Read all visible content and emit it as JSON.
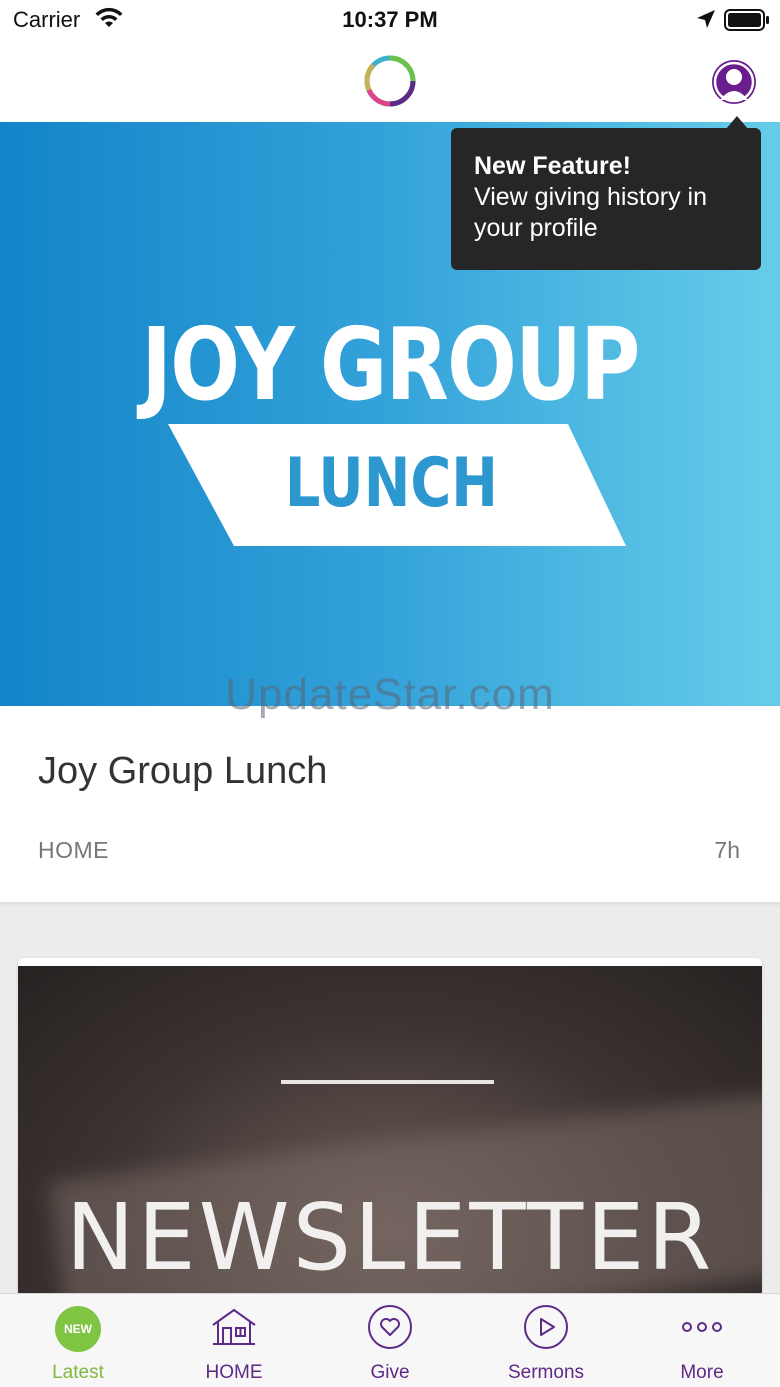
{
  "status_bar": {
    "carrier": "Carrier",
    "time": "10:37 PM"
  },
  "tooltip": {
    "title": "New Feature!",
    "body": "View giving history in your profile"
  },
  "hero": {
    "headline": "JOY GROUP",
    "subheadline": "LUNCH"
  },
  "watermark": "UpdateStar.com",
  "feed": [
    {
      "title": "Joy Group Lunch",
      "category": "HOME",
      "age": "7h"
    },
    {
      "image_text": "NEWSLETTER"
    }
  ],
  "tabbar": {
    "latest_badge": "NEW",
    "tabs": [
      {
        "label": "Latest",
        "icon": "new-badge-icon"
      },
      {
        "label": "HOME",
        "icon": "house-icon"
      },
      {
        "label": "Give",
        "icon": "heart-icon"
      },
      {
        "label": "Sermons",
        "icon": "play-icon"
      },
      {
        "label": "More",
        "icon": "more-dots-icon"
      }
    ]
  },
  "colors": {
    "brand_purple": "#5d2a87",
    "active_green": "#7fb840",
    "hero_gradient_start": "#1384c8",
    "hero_gradient_end": "#66cde9",
    "tooltip_bg": "#262626"
  }
}
